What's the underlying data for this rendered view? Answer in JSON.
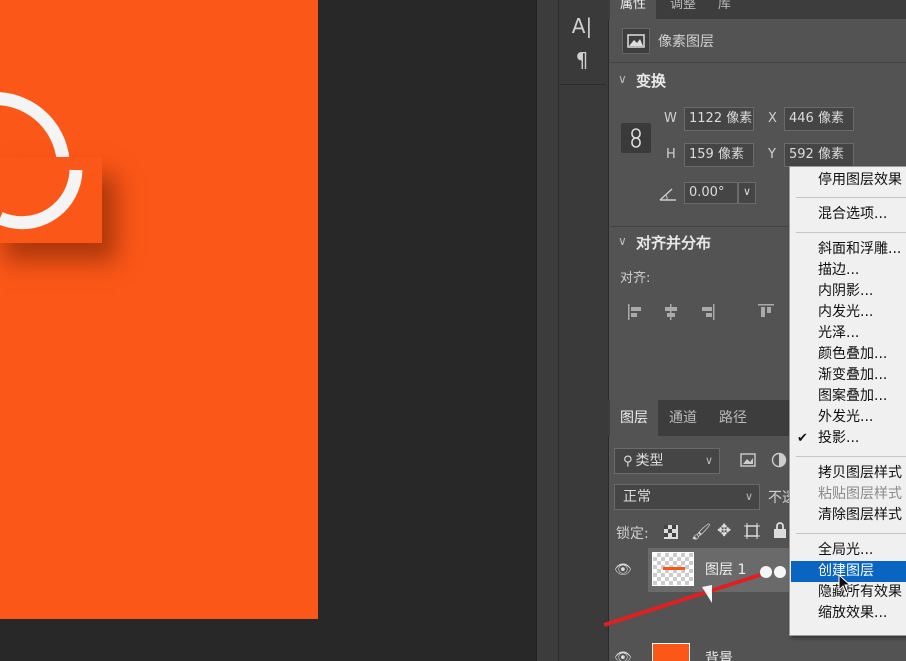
{
  "tools": {
    "type_icon": "A|",
    "paragraph_icon": "¶"
  },
  "properties": {
    "tabs": [
      "属性",
      "调整",
      "库"
    ],
    "layer_kind": "像素图层",
    "transform": {
      "title": "变换",
      "w_label": "W",
      "w_value": "1122 像素",
      "x_label": "X",
      "x_value": "446 像素",
      "h_label": "H",
      "h_value": "159 像素",
      "y_label": "Y",
      "y_value": "592 像素",
      "angle_value": "0.00°"
    },
    "align": {
      "title": "对齐并分布",
      "label": "对齐:"
    }
  },
  "layers": {
    "tabs": [
      "图层",
      "通道",
      "路径"
    ],
    "filter_label": "类型",
    "blend_mode": "正常",
    "opacity_label_partial": "不透",
    "lock_label": "锁定:",
    "layer1_name": "图层 1",
    "background_name": "背景"
  },
  "context_menu": {
    "items": [
      {
        "label": "停用图层效果",
        "state": "normal"
      },
      {
        "label": "混合选项...",
        "state": "normal"
      },
      {
        "label": "斜面和浮雕...",
        "state": "normal"
      },
      {
        "label": "描边...",
        "state": "normal"
      },
      {
        "label": "内阴影...",
        "state": "normal"
      },
      {
        "label": "内发光...",
        "state": "normal"
      },
      {
        "label": "光泽...",
        "state": "normal"
      },
      {
        "label": "颜色叠加...",
        "state": "normal"
      },
      {
        "label": "渐变叠加...",
        "state": "normal"
      },
      {
        "label": "图案叠加...",
        "state": "normal"
      },
      {
        "label": "外发光...",
        "state": "normal"
      },
      {
        "label": "投影...",
        "state": "checked"
      },
      {
        "label": "拷贝图层样式",
        "state": "normal"
      },
      {
        "label": "粘贴图层样式",
        "state": "disabled"
      },
      {
        "label": "清除图层样式",
        "state": "normal"
      },
      {
        "label": "全局光...",
        "state": "normal"
      },
      {
        "label": "创建图层",
        "state": "highlighted"
      },
      {
        "label": "隐藏所有效果",
        "state": "normal"
      },
      {
        "label": "缩放效果...",
        "state": "normal"
      }
    ]
  },
  "colors": {
    "canvas": "#fb5718",
    "highlight": "#0a64c2",
    "panel": "#535353"
  }
}
